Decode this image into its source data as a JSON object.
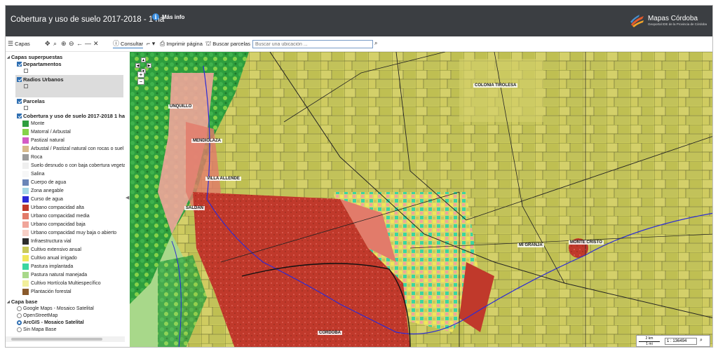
{
  "header": {
    "title": "Cobertura y uso de suelo 2017-2018 - 1 ha",
    "info_label": "Más info",
    "brand_name": "Mapas Córdoba",
    "brand_sub": "Geoportal IDE de la Provincia de Córdoba"
  },
  "toolbar": {
    "capas": "Capas",
    "consultar": "Consultar",
    "imprimir": "Imprimir página",
    "buscar_parcelas": "Buscar parcelas",
    "search_placeholder": "Buscar una ubicación ...",
    "icons": [
      "menu-icon",
      "pan-icon",
      "zoom-box-icon",
      "zoom-in-icon",
      "zoom-out-icon",
      "back-icon",
      "forward-icon",
      "full-extent-icon",
      "info-icon",
      "measure-icon",
      "print-icon",
      "parcel-icon",
      "search-icon"
    ]
  },
  "sidebar": {
    "overlay_group": "Capas superpuestas",
    "departamentos": "Departamentos",
    "radios_urbanos": "Radios Urbanos",
    "parcelas": "Parcelas",
    "cobertura": "Cobertura y uso de suelo 2017-2018 1 ha",
    "legend": [
      {
        "label": "Monte",
        "color": "#2e9e3e"
      },
      {
        "label": "Matorral / Arbustal",
        "color": "#86d24a"
      },
      {
        "label": "Pastizal natural",
        "color": "#d45bc6"
      },
      {
        "label": "Arbustal / Pastizal natural con rocas o suel",
        "color": "#d7b98a"
      },
      {
        "label": "Roca",
        "color": "#9c9c9c"
      },
      {
        "label": "Suelo desnudo o con baja cobertura vegeta",
        "color": "#efefef"
      },
      {
        "label": "Salina",
        "color": "#f7f7f7"
      },
      {
        "label": "Cuerpo de agua",
        "color": "#6b86b8"
      },
      {
        "label": "Zona anegable",
        "color": "#a6d8e6"
      },
      {
        "label": "Curso de agua",
        "color": "#2b2bd6"
      },
      {
        "label": "Urbano compacidad alta",
        "color": "#c0392b"
      },
      {
        "label": "Urbano compacidad media",
        "color": "#e27b6a"
      },
      {
        "label": "Urbano compacidad baja",
        "color": "#f0a59a"
      },
      {
        "label": "Urbano compacidad muy baja o abierto",
        "color": "#f7cfc6"
      },
      {
        "label": "Infraestructura vial",
        "color": "#2b2b2b"
      },
      {
        "label": "Cultivo extensivo anual",
        "color": "#c9c95a"
      },
      {
        "label": "Cultivo anual irrigado",
        "color": "#f0e65a"
      },
      {
        "label": "Pastura implantada",
        "color": "#3ad6a0"
      },
      {
        "label": "Pastura natural manejada",
        "color": "#a8d88a"
      },
      {
        "label": "Cultivo Hortícola Multiespecífico",
        "color": "#f2ef9a"
      },
      {
        "label": "Plantación forestal",
        "color": "#8a5a2b"
      }
    ],
    "base_group": "Capa base",
    "base_layers": [
      {
        "label": "Google Maps - Mosaico Satelital",
        "selected": false
      },
      {
        "label": "OpenStreetMap",
        "selected": false
      },
      {
        "label": "ArcGIS - Mosaico Satelital",
        "selected": true
      },
      {
        "label": "Sin Mapa Base",
        "selected": false
      }
    ]
  },
  "map": {
    "places": [
      "COLONIA TIROLESA",
      "UNQUILLO",
      "MENDIOLAZA",
      "VILLA ALLENDE",
      "SALDAN",
      "MI GRANJA",
      "MONTE CRISTO",
      "CORDOBA"
    ],
    "scale_km": "2 km",
    "scale_mi": "1 mi",
    "scale_value": "1 : 136494"
  }
}
